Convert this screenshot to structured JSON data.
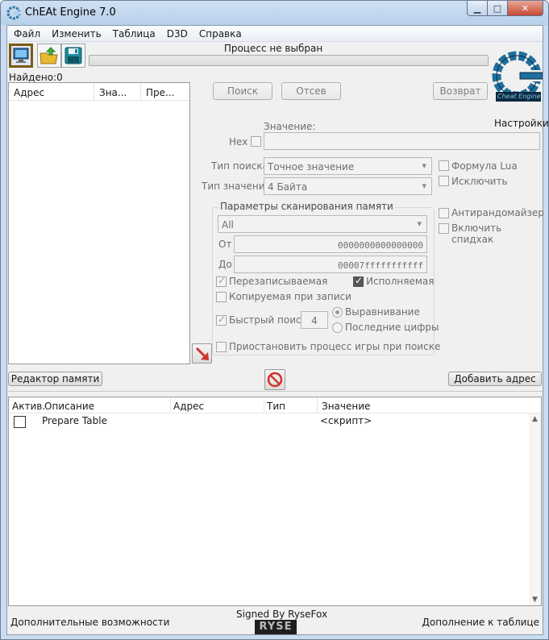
{
  "window": {
    "title": "ChEAt Engine 7.0"
  },
  "menu": [
    "Файл",
    "Изменить",
    "Таблица",
    "D3D",
    "Справка"
  ],
  "process_label": "Процесс не выбран",
  "found_label": "Найдено:0",
  "settings_label": "Настройки",
  "logo_text": "Cheat Engine",
  "results": {
    "columns": [
      "Адрес",
      "Зна...",
      "Пре..."
    ]
  },
  "scan": {
    "first_scan": "Поиск",
    "next_scan": "Отсев",
    "undo_scan": "Возврат",
    "value_label": "Значение:",
    "hex_label": "Hex",
    "scan_type_label": "Тип поиска",
    "scan_type_value": "Точное значение",
    "value_type_label": "Тип значения",
    "value_type_value": "4 Байта",
    "lua_formula": "Формула Lua",
    "not_label": "Исключить",
    "mem_group_title": "Параметры сканирования памяти",
    "region_value": "All",
    "from_label": "От",
    "from_value": "0000000000000000",
    "to_label": "До",
    "to_value": "00007fffffffffff",
    "writable": "Перезаписываемая",
    "executable": "Исполняемая",
    "copy_on_write": "Копируемая при записи",
    "fast_scan": "Быстрый поиск",
    "fast_scan_value": "4",
    "alignment": "Выравнивание",
    "last_digits": "Последние цифры",
    "pause_game": "Приостановить процесс игры при поиске",
    "unrandomizer": "Антирандомайзер",
    "speedhack": "Включить спидхак"
  },
  "buttons": {
    "memory_view": "Редактор памяти",
    "add_address": "Добавить адрес"
  },
  "table": {
    "columns": [
      "Актив.",
      "Описание",
      "Адрес",
      "Тип",
      "Значение"
    ],
    "rows": [
      {
        "description": "Prepare Table",
        "address": "",
        "type": "",
        "value": "<скрипт>"
      }
    ]
  },
  "footer": {
    "left": "Дополнительные возможности",
    "right": "Дополнение к таблице",
    "signed": "Signed By RyseFox",
    "badge": "RYSE"
  },
  "colors": {
    "logo_blue": "#1f6f9e",
    "red_arrow": "#d0342c",
    "stop_red": "#d0342c"
  }
}
